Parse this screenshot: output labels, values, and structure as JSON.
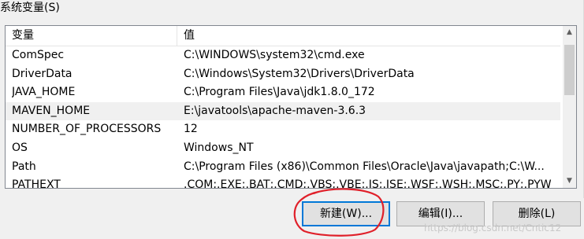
{
  "group": {
    "title": "系统变量(S)"
  },
  "table": {
    "columns": [
      "变量",
      "值"
    ],
    "rows": [
      {
        "name": "ComSpec",
        "value": "C:\\WINDOWS\\system32\\cmd.exe"
      },
      {
        "name": "DriverData",
        "value": "C:\\Windows\\System32\\Drivers\\DriverData"
      },
      {
        "name": "JAVA_HOME",
        "value": "C:\\Program Files\\Java\\jdk1.8.0_172"
      },
      {
        "name": "MAVEN_HOME",
        "value": "E:\\javatools\\apache-maven-3.6.3"
      },
      {
        "name": "NUMBER_OF_PROCESSORS",
        "value": "12"
      },
      {
        "name": "OS",
        "value": "Windows_NT"
      },
      {
        "name": "Path",
        "value": "C:\\Program Files (x86)\\Common Files\\Oracle\\Java\\javapath;C:\\W..."
      },
      {
        "name": "PATHEXT",
        "value": ".COM;.EXE;.BAT;.CMD;.VBS;.VBE;.JS;.JSE;.WSF;.WSH;.MSC;.PY;.PYW"
      }
    ],
    "selected_row": "MAVEN_HOME"
  },
  "scrollbar": {
    "up_icon": "chevron-up-icon",
    "down_icon": "chevron-down-icon"
  },
  "buttons": {
    "new_label": "新建(W)...",
    "edit_label": "编辑(I)...",
    "delete_label": "删除(L)"
  },
  "annotation": {
    "color": "#e0202a"
  },
  "watermark": "https://blog.csdn.net/Cntic12"
}
